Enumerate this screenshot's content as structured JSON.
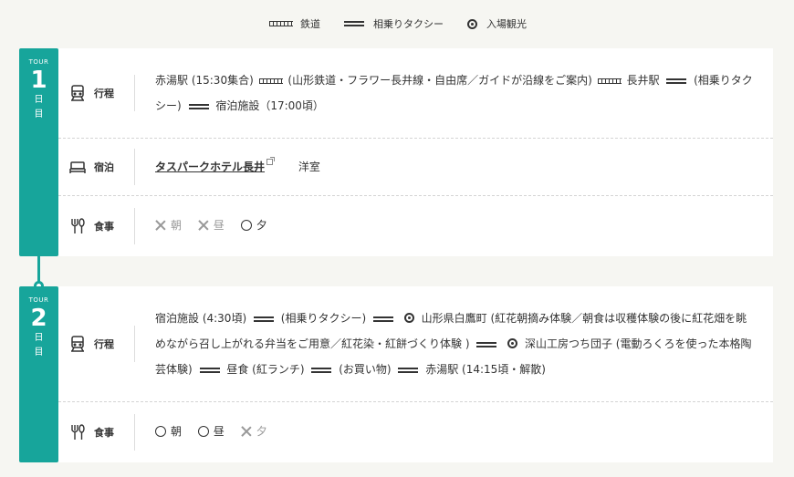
{
  "legend": {
    "railway": "鉄道",
    "taxi": "相乗りタクシー",
    "sightseeing": "入場観光"
  },
  "days": [
    {
      "tour_label": "TOUR",
      "number": "1",
      "kanji_top": "日",
      "kanji_bottom": "目",
      "itinerary_label": "行程",
      "itinerary": {
        "s1": "赤湯駅 (15:30集合)",
        "s2": "(山形鉄道・フラワー長井線・自由席／ガイドが沿線をご案内)",
        "s3": "長井駅",
        "s4": "(相乗りタクシー)",
        "s5": "宿泊施設（17:00頃）"
      },
      "lodging_label": "宿泊",
      "hotel": "タスパークホテル長井",
      "room": "洋室",
      "meal_label": "食事",
      "meals": {
        "breakfast": "朝",
        "lunch": "昼",
        "dinner": "夕"
      }
    },
    {
      "tour_label": "TOUR",
      "number": "2",
      "kanji_top": "日",
      "kanji_bottom": "目",
      "itinerary_label": "行程",
      "itinerary": {
        "s1": "宿泊施設 (4:30頃)",
        "s2": "(相乗りタクシー)",
        "s3": "山形県白鷹町 (紅花朝摘み体験／朝食は収穫体験の後に紅花畑を眺めながら召し上がれる弁当をご用意／紅花染・紅餅づくり体験 )",
        "s4": "深山工房つち団子 (電動ろくろを使った本格陶芸体験)",
        "s5": "昼食 (紅ランチ)",
        "s6": "(お買い物)",
        "s7": "赤湯駅 (14:15頃・解散)"
      },
      "meal_label": "食事",
      "meals": {
        "breakfast": "朝",
        "lunch": "昼",
        "dinner": "夕"
      }
    }
  ],
  "colors": {
    "accent": "#17a59b",
    "background": "#f6f6f2"
  },
  "icons": {
    "itinerary": "train-icon",
    "lodging": "bed-icon",
    "meal": "utensils-icon",
    "external": "external-link-icon"
  }
}
